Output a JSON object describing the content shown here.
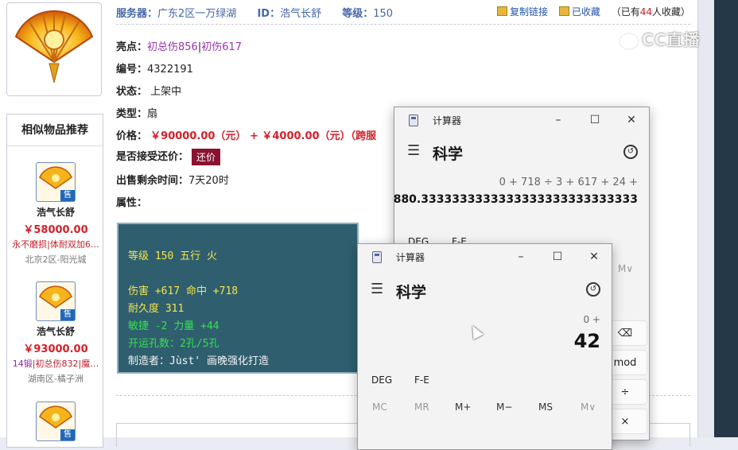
{
  "topbar": {
    "server_label": "服务器：",
    "server_value": "广东2区一万绿湖",
    "id_label": "ID：",
    "id_value": "浩气长舒",
    "level_label": "等级：",
    "level_value": "150",
    "copy_link": "复制链接",
    "favorited": "已收藏",
    "fav_prefix": "（已有",
    "fav_count": "44",
    "fav_suffix": "人收藏）"
  },
  "watermark": "CC直播",
  "details": {
    "highlight_label": "亮点：",
    "highlight_1": "初总伤856",
    "highlight_sep": "|",
    "highlight_2": "初伤617",
    "number_label": "编号：",
    "number_value": "4322191",
    "status_label": "状态：",
    "status_value": "上架中",
    "type_label": "类型：",
    "type_value": "扇",
    "price_label": "价格：",
    "price_value": "￥90000.00（元） + ￥4000.00（元）（跨服",
    "counter_label": "是否接受还价：",
    "counter_button": "还价",
    "remaining_label": "出售剩余时间：",
    "remaining_value": "7天20时",
    "attr_label": "属性："
  },
  "attributes": {
    "line1": "等级 150 五行 火",
    "line2": "伤害 +617 命中 +718",
    "line3": "耐久度 311",
    "line4": "敏捷 -2 力量 +44",
    "line5": "开运孔数：2孔/5孔",
    "line6": "制造者：Jùst' 画晚强化打造"
  },
  "sidebar": {
    "title": "相似物品推荐",
    "items": [
      {
        "name": "浩气长舒",
        "price": "￥58000.00",
        "desc": "永不磨损|体耐双加6…",
        "server": "北京2区-阳光城",
        "tag": "售"
      },
      {
        "name": "浩气长舒",
        "price": "￥93000.00",
        "desc_purple": "14锻",
        "desc": "|初总伤832|魔…",
        "server": "湖南区-橘子洲",
        "tag": "售"
      },
      {
        "tag": "售"
      }
    ]
  },
  "calc_back": {
    "title": "计算器",
    "mode": "科学",
    "expression": "0 + 718 ÷ 3 + 617 + 24 +",
    "result": "880.3333333333333333333333333333",
    "deg": "DEG",
    "fe": "F-E",
    "mem_more": "M∨",
    "mod": "mod",
    "divide": "÷",
    "multiply": "×",
    "backspace": "⌫"
  },
  "calc_front": {
    "title": "计算器",
    "mode": "科学",
    "expression": "0 +",
    "result": "42",
    "deg": "DEG",
    "fe": "F-E",
    "mc": "MC",
    "mr": "MR",
    "mplus": "M+",
    "mminus": "M−",
    "ms": "MS",
    "mdrop": "M∨"
  },
  "colors": {
    "accent_blue": "#4466aa",
    "price_red": "#d3202a",
    "attr_bg": "#2f5f6f",
    "attr_yellow": "#f5e44a",
    "attr_green": "#34e04e"
  }
}
